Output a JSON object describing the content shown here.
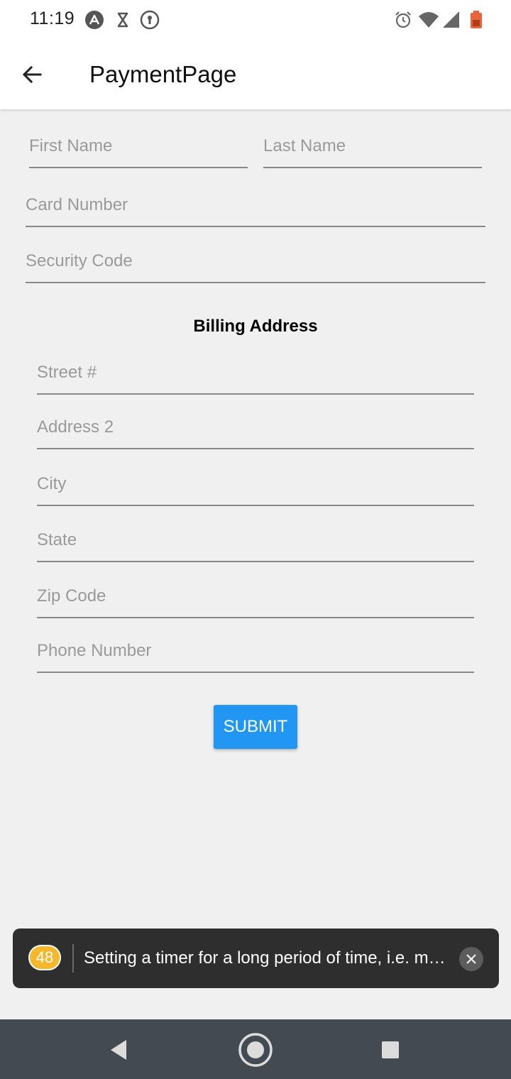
{
  "status_bar": {
    "time": "11:19",
    "left_icons": [
      "a-logo-icon",
      "hourglass-icon",
      "keyhole-icon"
    ],
    "right_icons": [
      "alarm-icon",
      "wifi-icon",
      "signal-icon",
      "battery-icon"
    ],
    "battery_color": "#e8643c"
  },
  "app_bar": {
    "title": "PaymentPage",
    "back_icon": "arrow-left-icon"
  },
  "form": {
    "first_name": {
      "placeholder": "First Name",
      "value": ""
    },
    "last_name": {
      "placeholder": "Last Name",
      "value": ""
    },
    "card_number": {
      "placeholder": "Card Number",
      "value": ""
    },
    "security_code": {
      "placeholder": "Security Code",
      "value": ""
    },
    "billing_title": "Billing Address",
    "street": {
      "placeholder": "Street #",
      "value": ""
    },
    "address2": {
      "placeholder": "Address 2",
      "value": ""
    },
    "city": {
      "placeholder": "City",
      "value": ""
    },
    "state": {
      "placeholder": "State",
      "value": ""
    },
    "zip": {
      "placeholder": "Zip Code",
      "value": ""
    },
    "phone": {
      "placeholder": "Phone Number",
      "value": ""
    },
    "submit_label": "SUBMIT"
  },
  "toast": {
    "count": "48",
    "message": "Setting a timer for a long period of time, i.e. multiple minutes, is a performance and correctness issue on Android",
    "badge_color": "#f5b72b"
  },
  "nav_bar": {
    "icons": [
      "back-triangle-icon",
      "home-circle-icon",
      "recents-square-icon"
    ]
  },
  "colors": {
    "accent": "#2196f3",
    "background": "#f0f0f0",
    "nav_bar": "#434a51"
  }
}
